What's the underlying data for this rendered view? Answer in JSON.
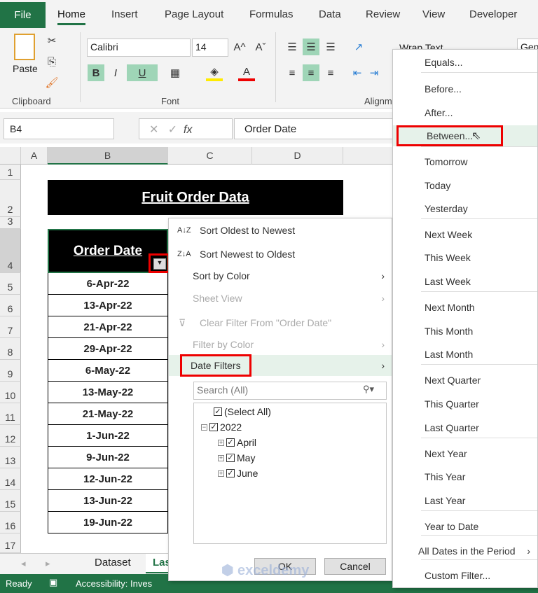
{
  "ribbon_tabs": [
    "File",
    "Home",
    "Insert",
    "Page Layout",
    "Formulas",
    "Data",
    "Review",
    "View",
    "Developer"
  ],
  "ribbon": {
    "paste": "Paste",
    "clipboard": "Clipboard",
    "font_name": "Calibri",
    "font_size": "14",
    "font": "Font",
    "alignment": "Alignm",
    "wrap_text": "Wrap Text",
    "number_format": "Gen",
    "bold": "B",
    "italic": "I",
    "underline": "U",
    "grow": "A^",
    "shrink": "Aˇ",
    "font_color": "A"
  },
  "formula_bar": {
    "name_box": "B4",
    "fx": "fx",
    "value": "Order Date"
  },
  "columns": [
    "A",
    "B",
    "C",
    "D"
  ],
  "rows": [
    "1",
    "2",
    "3",
    "4",
    "5",
    "6",
    "7",
    "8",
    "9",
    "10",
    "11",
    "12",
    "13",
    "14",
    "15",
    "16",
    "17"
  ],
  "sheet": {
    "title": "Fruit Order Data",
    "header": "Order Date",
    "dates": [
      "6-Apr-22",
      "13-Apr-22",
      "21-Apr-22",
      "29-Apr-22",
      "6-May-22",
      "13-May-22",
      "21-May-22",
      "1-Jun-22",
      "9-Jun-22",
      "12-Jun-22",
      "13-Jun-22",
      "19-Jun-22"
    ]
  },
  "filter_menu": {
    "sort_asc": "Sort Oldest to Newest",
    "sort_desc": "Sort Newest to Oldest",
    "sort_color": "Sort by Color",
    "sheet_view": "Sheet View",
    "clear": "Clear Filter From \"Order Date\"",
    "filter_color": "Filter by Color",
    "date_filters": "Date Filters",
    "search_placeholder": "Search (All)",
    "tree": {
      "select_all": "(Select All)",
      "year": "2022",
      "months": [
        "April",
        "May",
        "June"
      ]
    },
    "ok": "OK",
    "cancel": "Cancel"
  },
  "date_submenu": [
    "Equals...",
    "Before...",
    "After...",
    "Between...",
    "Tomorrow",
    "Today",
    "Yesterday",
    "Next Week",
    "This Week",
    "Last Week",
    "Next Month",
    "This Month",
    "Last Month",
    "Next Quarter",
    "This Quarter",
    "Last Quarter",
    "Next Year",
    "This Year",
    "Last Year",
    "Year to Date",
    "All Dates in the Period",
    "Custom Filter..."
  ],
  "sheet_tabs": [
    "Dataset",
    "Las"
  ],
  "status": {
    "ready": "Ready",
    "accessibility": "Accessibility: Inves"
  },
  "watermark": "exceldemy EXCEL · DATA · BI",
  "colors": {
    "excel_green": "#217346",
    "highlight": "#ff0000",
    "selected_bg": "#e6f2ea"
  }
}
